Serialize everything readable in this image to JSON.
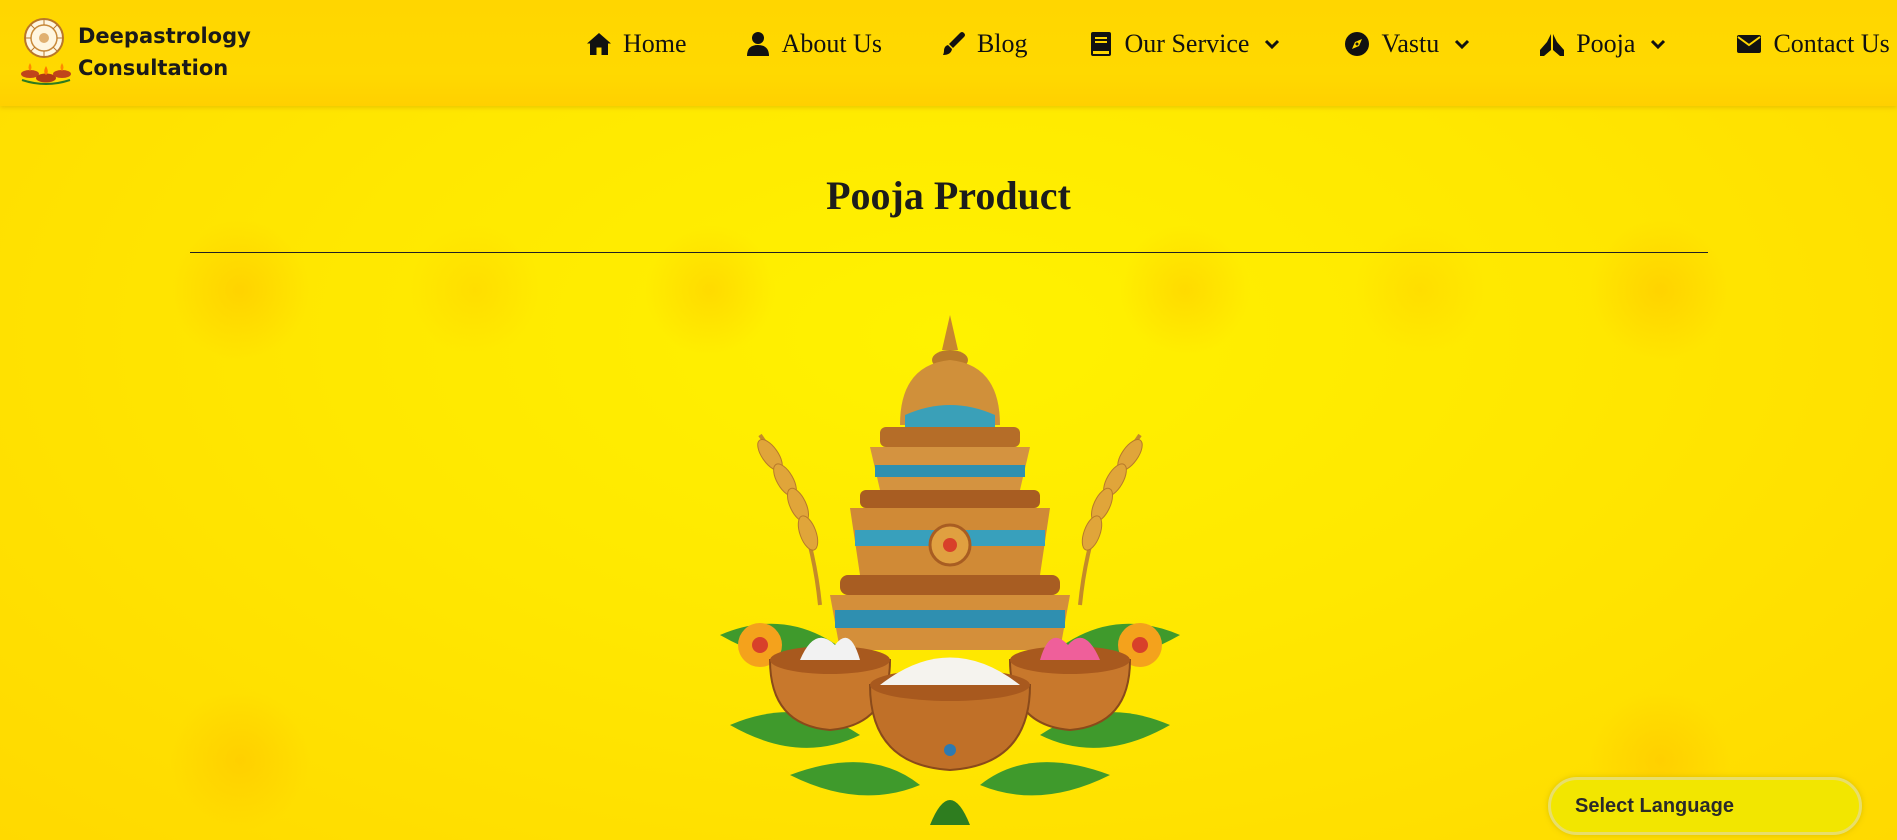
{
  "header": {
    "brand_line1": "Deepastrology",
    "brand_line2": "Consultation",
    "nav": [
      {
        "label": "Home",
        "icon": "home-icon"
      },
      {
        "label": "About Us",
        "icon": "user-icon"
      },
      {
        "label": "Blog",
        "icon": "pen-brush-icon"
      },
      {
        "label": "Our Service",
        "icon": "book-icon",
        "dropdown": true
      },
      {
        "label": "Vastu",
        "icon": "compass-icon",
        "dropdown": true
      },
      {
        "label": "Pooja",
        "icon": "praying-hands-icon",
        "dropdown": true
      },
      {
        "label": "Contact Us",
        "icon": "envelope-icon"
      }
    ]
  },
  "main": {
    "title": "Pooja Product"
  },
  "language_selector": {
    "label": "Select Language"
  },
  "colors": {
    "background": "#ffe600",
    "header": "#ffd600",
    "text": "#111111"
  }
}
